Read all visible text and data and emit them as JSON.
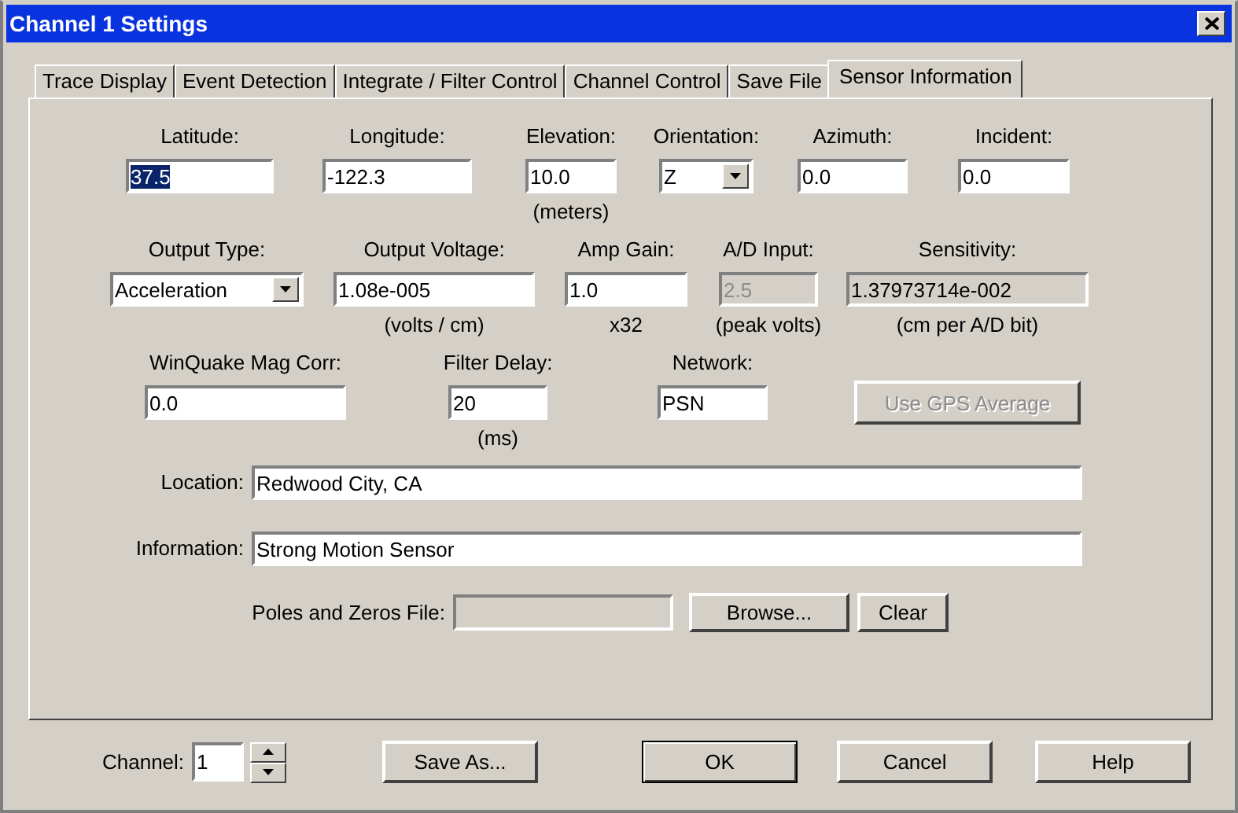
{
  "window": {
    "title": "Channel 1 Settings"
  },
  "tabs": [
    {
      "label": "Trace Display",
      "selected": false
    },
    {
      "label": "Event Detection",
      "selected": false
    },
    {
      "label": "Integrate / Filter Control",
      "selected": false
    },
    {
      "label": "Channel Control",
      "selected": false
    },
    {
      "label": "Save File",
      "selected": false
    },
    {
      "label": "Sensor Information",
      "selected": true
    }
  ],
  "field_rows": [
    {
      "fields": [
        {
          "label": "Latitude:",
          "kind": "text",
          "value": "37.5",
          "highlighted": true,
          "disabled": false
        },
        {
          "label": "Longitude:",
          "kind": "text",
          "value": "-122.3",
          "highlighted": false,
          "disabled": false
        },
        {
          "label": "Elevation:",
          "kind": "text",
          "value": "10.0",
          "note": "(meters)",
          "highlighted": false,
          "disabled": false
        },
        {
          "label": "Orientation:",
          "kind": "dropdown",
          "value": "Z",
          "highlighted": false,
          "disabled": false
        },
        {
          "label": "Azimuth:",
          "kind": "text",
          "value": "0.0",
          "highlighted": false,
          "disabled": false
        },
        {
          "label": "Incident:",
          "kind": "text",
          "value": "0.0",
          "highlighted": false,
          "disabled": false
        }
      ]
    },
    {
      "fields": [
        {
          "label": "Output Type:",
          "kind": "dropdown",
          "value": "Acceleration",
          "highlighted": false,
          "disabled": false
        },
        {
          "label": "Output Voltage:",
          "kind": "text",
          "value": "1.08e-005",
          "note": "(volts / cm)",
          "highlighted": false,
          "disabled": false
        },
        {
          "label": "Amp Gain:",
          "kind": "text",
          "value": "1.0",
          "note": "x32",
          "highlighted": false,
          "disabled": false
        },
        {
          "label": "A/D Input:",
          "kind": "text",
          "value": "2.5",
          "note": "(peak volts)",
          "highlighted": false,
          "disabled": true
        },
        {
          "label": "Sensitivity:",
          "kind": "readonly",
          "value": "1.37973714e-002",
          "note": "(cm per A/D bit)",
          "highlighted": false,
          "disabled": false
        }
      ]
    },
    {
      "fields": [
        {
          "label": "WinQuake Mag Corr:",
          "kind": "text",
          "value": "0.0",
          "highlighted": false,
          "disabled": false
        },
        {
          "label": "Filter Delay:",
          "kind": "text",
          "value": "20",
          "note": "(ms)",
          "highlighted": false,
          "disabled": false
        },
        {
          "label": "Network:",
          "kind": "text",
          "value": "PSN",
          "highlighted": false,
          "disabled": false
        },
        {
          "label": "Use GPS Average",
          "kind": "button",
          "disabled": true
        }
      ]
    }
  ],
  "wide_fields": [
    {
      "label": "Location:",
      "value": "Redwood City, CA"
    },
    {
      "label": "Information:",
      "value": "Strong Motion Sensor"
    }
  ],
  "poles_zeros": {
    "label": "Poles and Zeros File:",
    "buttons": [
      "Browse...",
      "Clear"
    ]
  },
  "footer": {
    "channel_label": "Channel:",
    "channel_value": "1",
    "buttons": [
      {
        "label": "Save As...",
        "default": false
      },
      {
        "label": "OK",
        "default": true
      },
      {
        "label": "Cancel",
        "default": false
      },
      {
        "label": "Help",
        "default": false
      }
    ]
  }
}
